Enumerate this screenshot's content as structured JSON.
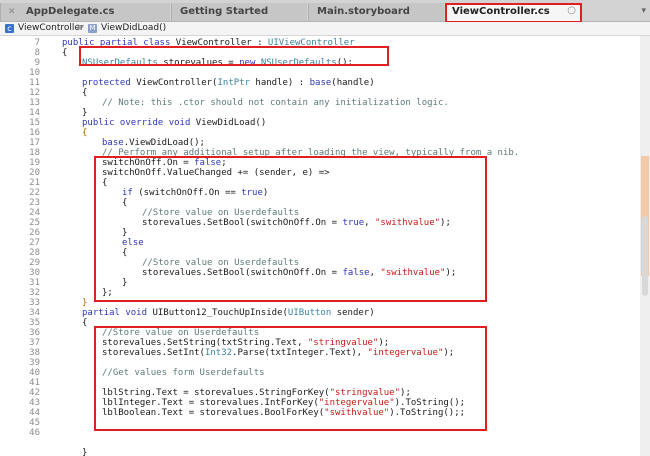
{
  "tabs": [
    {
      "label": "AppDelegate.cs",
      "active": false
    },
    {
      "label": "Getting Started",
      "active": false
    },
    {
      "label": "Main.storyboard",
      "active": false
    },
    {
      "label": "ViewController.cs",
      "active": true
    }
  ],
  "jumpbar": {
    "file": "ViewController",
    "sep": ">",
    "method": "ViewDidLoad()"
  },
  "line_numbers": [
    "7",
    "8",
    "9",
    "10",
    "11",
    "12",
    "13",
    "14",
    "15",
    "16",
    "17",
    "18",
    "19",
    "20",
    "21",
    "22",
    "23",
    "24",
    "25",
    "26",
    "27",
    "28",
    "29",
    "30",
    "31",
    "32",
    "33",
    "34",
    "35",
    "36",
    "37",
    "38",
    "39",
    "40",
    "41",
    "42",
    "43",
    "44",
    "45",
    "46"
  ],
  "code": {
    "l1a": "public partial class ",
    "l1b": "ViewController",
    "l1c": " : ",
    "l1d": "UIViewController",
    "l2": "{",
    "l3a": "NSUserDefaults",
    "l3b": " storevalues = ",
    "l3c": "new",
    "l3d": " NSUserDefaults",
    "l3e": "();",
    "l4a": "protected",
    "l4b": " ViewController(",
    "l4c": "IntPtr",
    "l4d": " handle) : ",
    "l4e": "base",
    "l4f": "(handle)",
    "l5": "{",
    "l6": "// Note: this .ctor should not contain any initialization logic.",
    "l7": "}",
    "l8a": "public override void",
    "l8b": " ViewDidLoad()",
    "l9": "{",
    "l10a": "base",
    "l10b": ".ViewDidLoad();",
    "l11": "// Perform any additional setup after loading the view, typically from a nib.",
    "l12a": "switchOnOff.On = ",
    "l12b": "false",
    "l12c": ";",
    "l13": "switchOnOff.ValueChanged += (sender, e) =>",
    "l14": "{",
    "l15a": "if",
    "l15b": " (switchOnOff.On == ",
    "l15c": "true",
    "l15d": ")",
    "l16": "{",
    "l17": "//Store value on Userdefaults",
    "l18a": "storevalues.SetBool(switchOnOff.On = ",
    "l18b": "true",
    "l18c": ", ",
    "l18d": "\"swithvalue\"",
    "l18e": ");",
    "l19": "}",
    "l20": "else",
    "l21": "{",
    "l22": "//Store value on Userdefaults",
    "l23a": "storevalues.SetBool(switchOnOff.On = ",
    "l23b": "false",
    "l23c": ", ",
    "l23d": "\"swithvalue\"",
    "l23e": ");",
    "l24": "}",
    "l25": "};",
    "l26": "}",
    "l27a": "partial void",
    "l27b": " UIButton12_TouchUpInside(",
    "l27c": "UIButton",
    "l27d": " sender)",
    "l28": "{",
    "l29": "//Store value on Userdefaults",
    "l30a": "storevalues.SetString(txtString.Text, ",
    "l30b": "\"stringvalue\"",
    "l30c": ");",
    "l31a": "storevalues.SetInt(",
    "l31b": "Int32",
    "l31c": ".Parse(txtInteger.Text), ",
    "l31d": "\"integervalue\"",
    "l31e": ");",
    "l33": "//Get values form Userdefaults",
    "l35a": "lblString.Text = storevalues.StringForKey(",
    "l35b": "\"stringvalue\"",
    "l35c": ");",
    "l36a": "lblInteger.Text = storevalues.IntForKey(",
    "l36b": "\"integervalue\"",
    "l36c": ").ToString();",
    "l37a": "lblBoolean.Text = storevalues.BoolForKey(",
    "l37b": "\"swithvalue\"",
    "l37c": ").ToString();;",
    "l40": "}"
  },
  "colors": {
    "highlight": "#e02020",
    "keyword": "#2f36b6",
    "type": "#3a82a0",
    "string": "#c41a16",
    "comment": "#5f7a7a"
  }
}
